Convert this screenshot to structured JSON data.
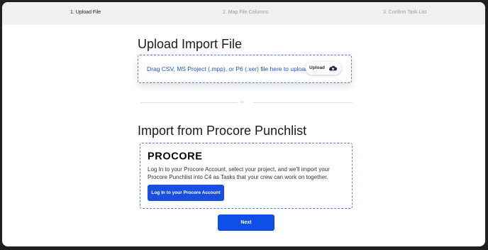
{
  "steps": [
    {
      "label": "1. Upload File",
      "active": true
    },
    {
      "label": "2. Map File Columns",
      "active": false
    },
    {
      "label": "3. Confirm Task List",
      "active": false
    }
  ],
  "upload": {
    "title": "Upload Import File",
    "dropzone_text": "Drag CSV, MS Project (.mpp), or P6 (.xer) file here to upload",
    "button_label": "Upload",
    "button_icon": "cloud-upload-icon"
  },
  "separator": {
    "label": "or"
  },
  "procore": {
    "title": "Import from Procore Punchlist",
    "logo_text": "PROCORE",
    "description": "Log In to your Procore Account, select your project, and we'll import your Procore Punchlist into C4 as Tasks that your crew can work on together.",
    "login_label": "Log In to your Procore Account"
  },
  "footer": {
    "next_label": "Next"
  },
  "colors": {
    "accent": "#1a4ee0",
    "link_text": "#1a56db",
    "border": "#5a7de8"
  }
}
